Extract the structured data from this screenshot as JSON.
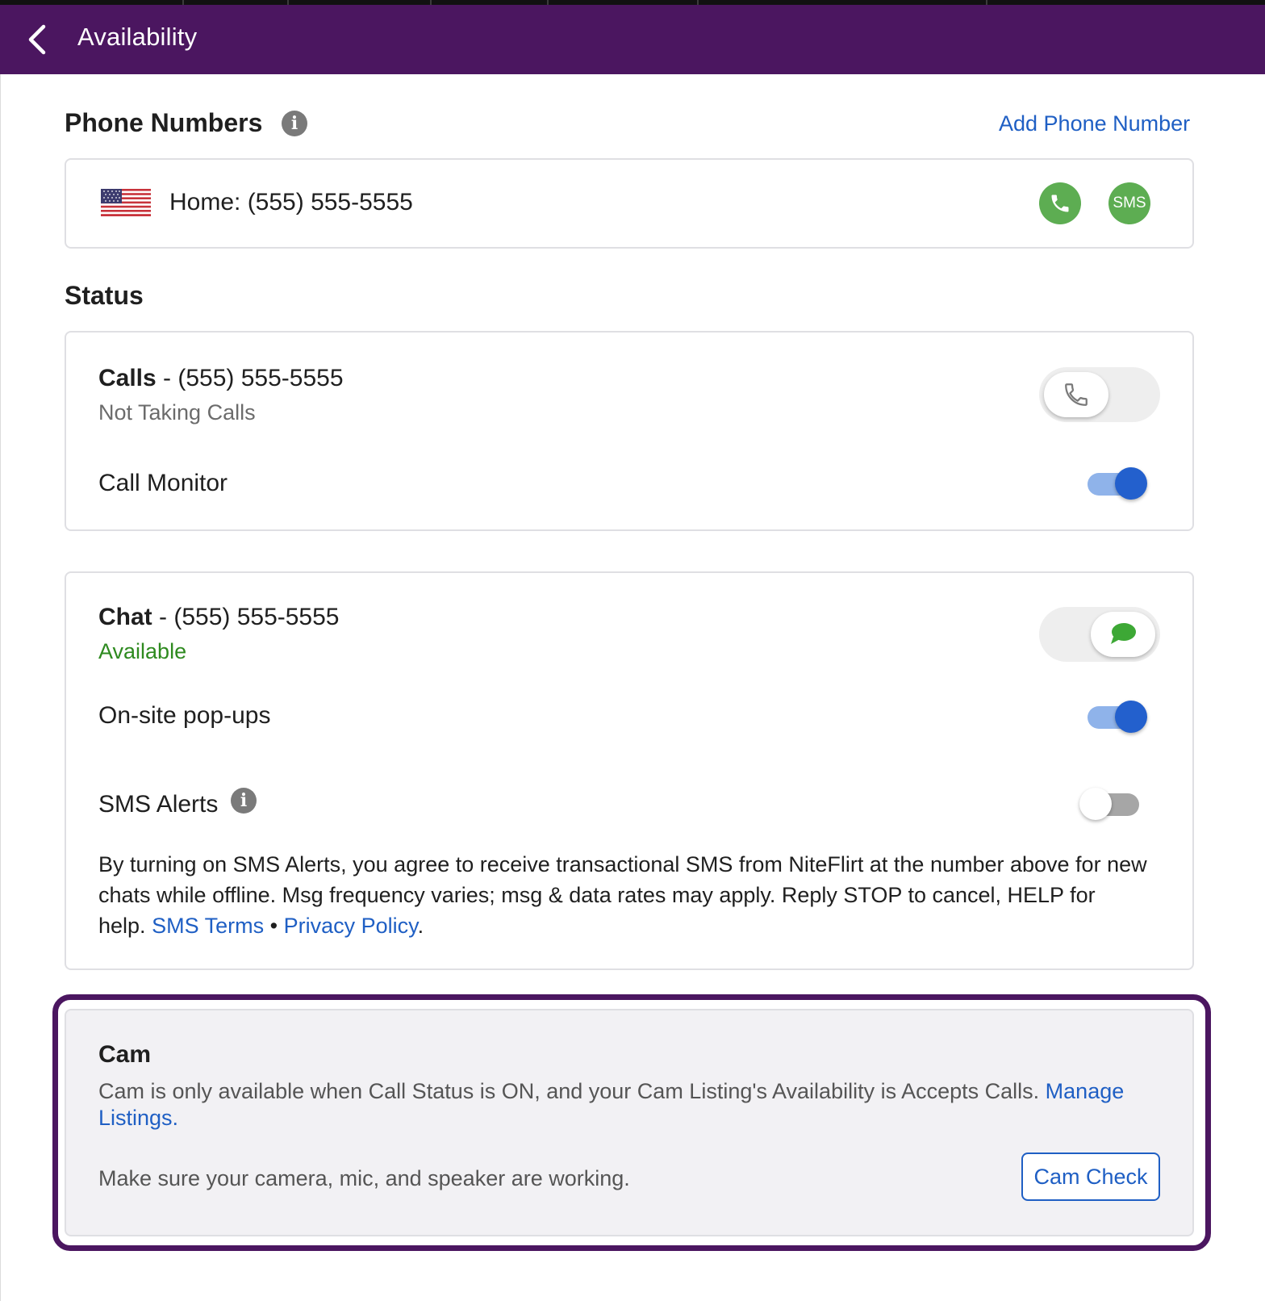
{
  "appbar": {
    "title": "Availability",
    "background": "#4b1660"
  },
  "phone_numbers": {
    "heading": "Phone Numbers",
    "add_link": "Add Phone Number",
    "entries": [
      {
        "flag": "us-flag-icon",
        "label": "Home: (555) 555-5555",
        "call_button": "phone-icon",
        "sms_button": "SMS"
      }
    ]
  },
  "status": {
    "heading": "Status",
    "calls": {
      "title": "Calls",
      "number": " - (555) 555-5555",
      "state": "Not Taking Calls",
      "toggle_on": false,
      "call_monitor_label": "Call Monitor",
      "call_monitor_on": true
    },
    "chat": {
      "title": "Chat",
      "number": " - (555) 555-5555",
      "state": "Available",
      "state_color": "#2e8a1f",
      "toggle_on": true,
      "popups_label": "On-site pop-ups",
      "popups_on": true,
      "sms_alerts_label": "SMS Alerts",
      "sms_alerts_on": false,
      "disclaimer": "By turning on SMS Alerts, you agree to receive transactional SMS from NiteFlirt at the number above for new chats while offline. Msg frequency varies; msg & data rates may apply. Reply STOP to cancel, HELP for help.",
      "sms_terms_link": "SMS Terms",
      "separator": " • ",
      "privacy_link": "Privacy Policy",
      "end_period": "."
    }
  },
  "cam": {
    "title": "Cam",
    "description": "Cam is only available when Call Status is ON, and your Cam Listing's Availability is Accepts Calls.",
    "manage_link": "Manage Listings",
    "end_period": ".",
    "check_text": "Make sure your camera, mic, and speaker are working.",
    "check_button": "Cam Check"
  },
  "colors": {
    "accent_purple": "#4b1660",
    "link_blue": "#1f5fc4",
    "green": "#5dad52",
    "switch_blue": "#2360cd"
  }
}
